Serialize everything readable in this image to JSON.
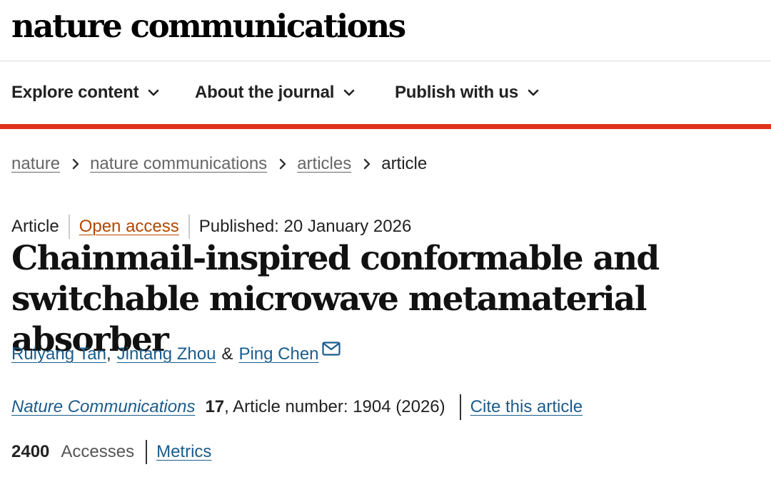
{
  "site": {
    "logo": "nature communications"
  },
  "nav": {
    "items": [
      {
        "label": "Explore content"
      },
      {
        "label": "About the journal"
      },
      {
        "label": "Publish with us"
      }
    ]
  },
  "breadcrumb": {
    "items": [
      "nature",
      "nature communications",
      "articles"
    ],
    "current": "article"
  },
  "article": {
    "type": "Article",
    "access": "Open access",
    "published": "Published: 20 January 2026",
    "title": "Chainmail-inspired conformable and switchable microwave metamaterial absorber",
    "authors": [
      "Ruiyang Tan",
      "Jintang Zhou",
      "Ping Chen"
    ],
    "author_sep_comma": ",",
    "author_sep_amp": "&",
    "journal": "Nature Communications",
    "volume": "17",
    "article_number": ", Article number: 1904 (2026)",
    "cite_label": "Cite this article",
    "accesses_count": "2400",
    "accesses_label": "Accesses",
    "metrics_label": "Metrics"
  },
  "colors": {
    "accent_bar": "#e0311a",
    "link": "#1b5c8c",
    "open_access": "#b34700"
  },
  "icons": {
    "dropdown": "chevron-down-icon",
    "breadcrumb_sep": "chevron-right-icon",
    "contact": "envelope-icon"
  }
}
